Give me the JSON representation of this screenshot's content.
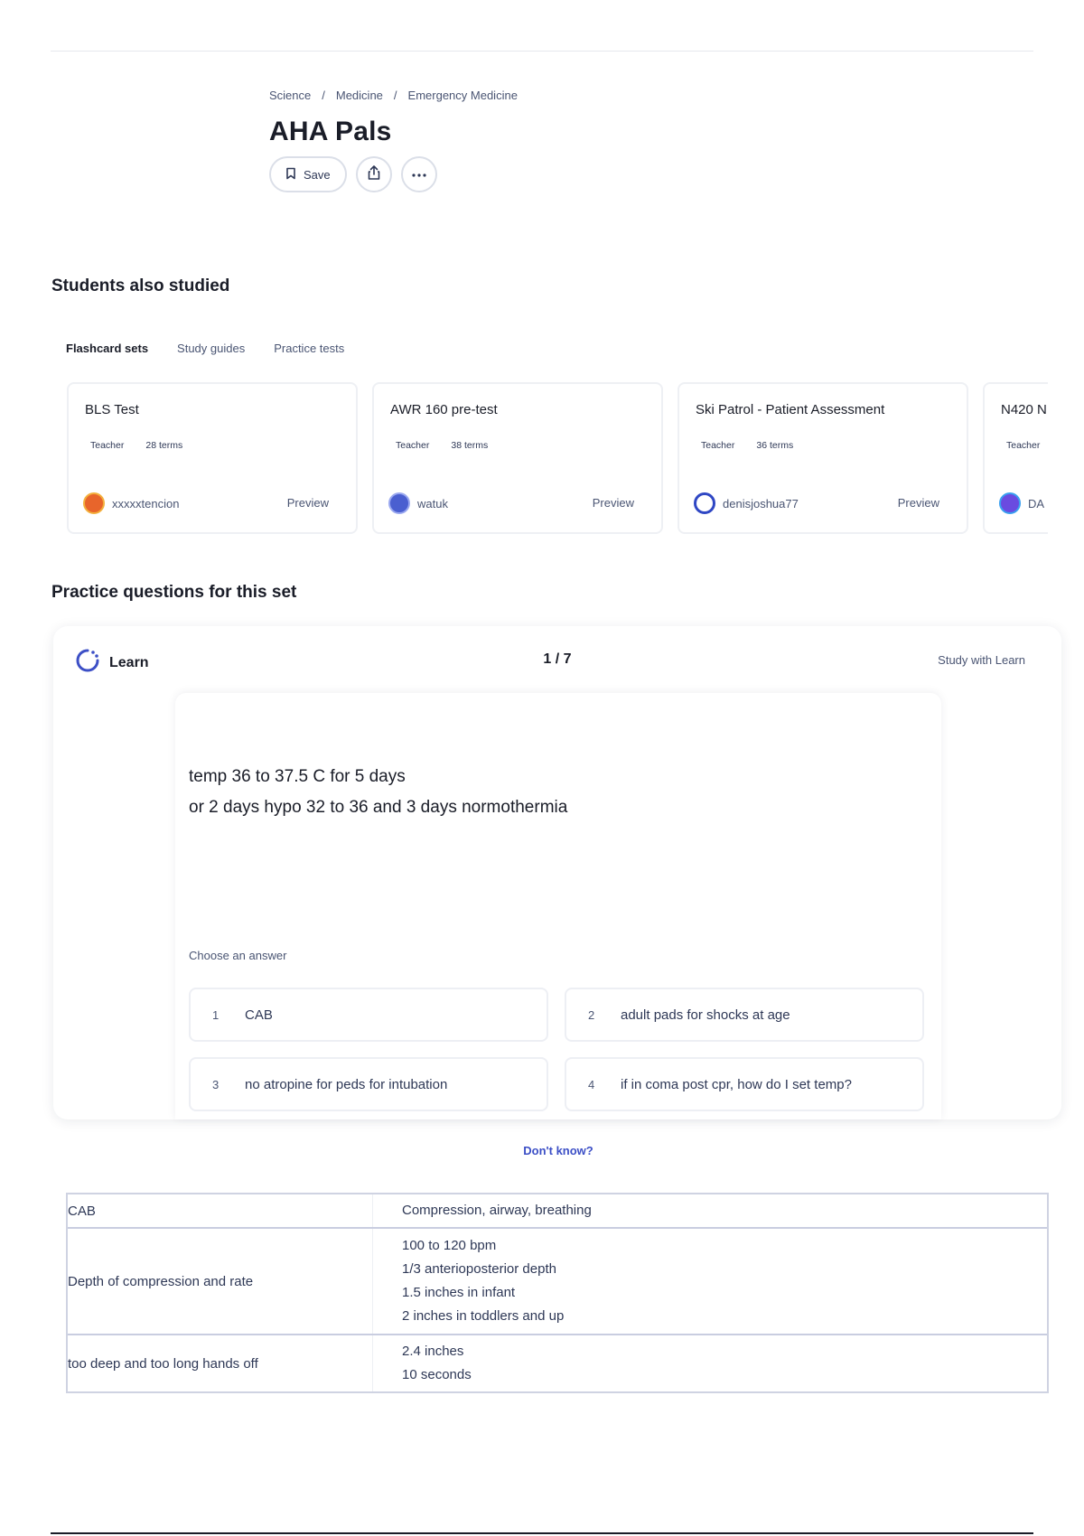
{
  "breadcrumb": [
    "Science",
    "Medicine",
    "Emergency Medicine"
  ],
  "title": "AHA Pals",
  "actions": {
    "save_label": "Save"
  },
  "students_also_studied": {
    "heading": "Students also studied",
    "tabs": [
      "Flashcard sets",
      "Study guides",
      "Practice tests"
    ],
    "active_tab": "Flashcard sets",
    "cards": [
      {
        "title": "BLS Test",
        "role": "Teacher",
        "terms": "28 terms",
        "user": "xxxxxtencion",
        "preview": "Preview",
        "avatar_color": "#e8652b"
      },
      {
        "title": "AWR 160 pre-test",
        "role": "Teacher",
        "terms": "38 terms",
        "user": "watuk",
        "preview": "Preview",
        "avatar_color": "#4a5fd0"
      },
      {
        "title": "Ski Patrol - Patient Assessment",
        "role": "Teacher",
        "terms": "36 terms",
        "user": "denisjoshua77",
        "preview": "Preview",
        "avatar_color": "#2f47c4"
      },
      {
        "title": "N420 N",
        "role": "Teacher",
        "terms": "",
        "user": "DA",
        "preview": "",
        "avatar_color": "#6a4be0"
      }
    ]
  },
  "practice": {
    "heading": "Practice questions for this set",
    "mode_label": "Learn",
    "counter": "1 / 7",
    "study_link": "Study with Learn",
    "question_lines": [
      "temp 36 to 37.5 C for 5 days",
      "or 2 days hypo 32 to 36 and 3 days normothermia"
    ],
    "choose_label": "Choose an answer",
    "options": [
      {
        "num": "1",
        "text": "CAB"
      },
      {
        "num": "2",
        "text": "adult pads for shocks at age"
      },
      {
        "num": "3",
        "text": "no atropine for peds for intubation"
      },
      {
        "num": "4",
        "text": "if in coma post cpr, how do I set temp?"
      }
    ],
    "dont_know": "Don't know?"
  },
  "terms": [
    {
      "term": "CAB",
      "definition": [
        "Compression, airway, breathing"
      ]
    },
    {
      "term": "Depth of compression and rate",
      "definition": [
        "100 to 120 bpm",
        "1/3 anterioposterior depth",
        "1.5 inches in infant",
        "2 inches in toddlers and up"
      ]
    },
    {
      "term": "too deep and too long hands off",
      "definition": [
        "2.4 inches",
        "10 seconds"
      ]
    }
  ],
  "colors": {
    "accent": "#3c4fc6",
    "text": "#1a1d28",
    "muted": "#4a5573"
  }
}
